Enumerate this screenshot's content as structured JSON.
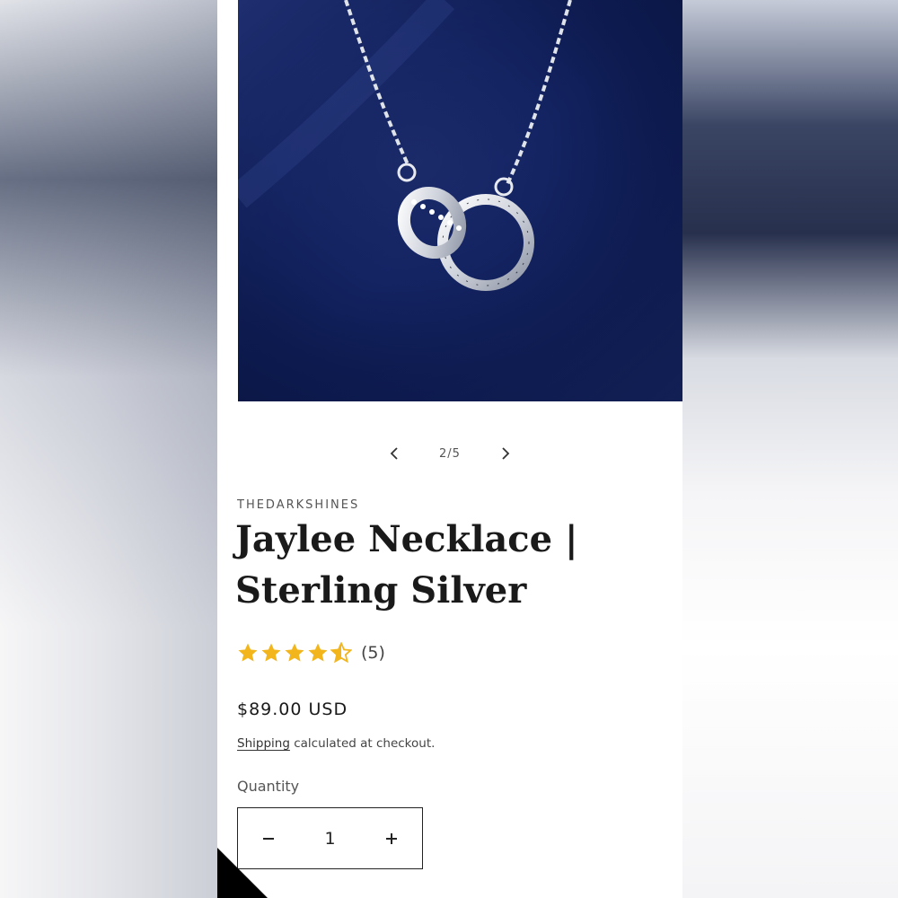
{
  "slider": {
    "counter": "2/5",
    "prev_icon": "chevron-left-icon",
    "next_icon": "chevron-right-icon"
  },
  "product": {
    "vendor": "THEDARKSHINES",
    "title": "Jaylee Necklace | Sterling Silver",
    "rating_value": 4.5,
    "rating_max": 5,
    "review_count": "(5)",
    "price": "$89.00 USD",
    "shipping_link": "Shipping",
    "shipping_text": " calculated at checkout.",
    "image_alt": "necklace-photo"
  },
  "quantity": {
    "label": "Quantity",
    "value": "1",
    "minus_icon": "minus-icon",
    "plus_icon": "plus-icon"
  },
  "colors": {
    "star": "#F2B51C",
    "image_bg": "#142463",
    "text": "#1a1a1a"
  }
}
